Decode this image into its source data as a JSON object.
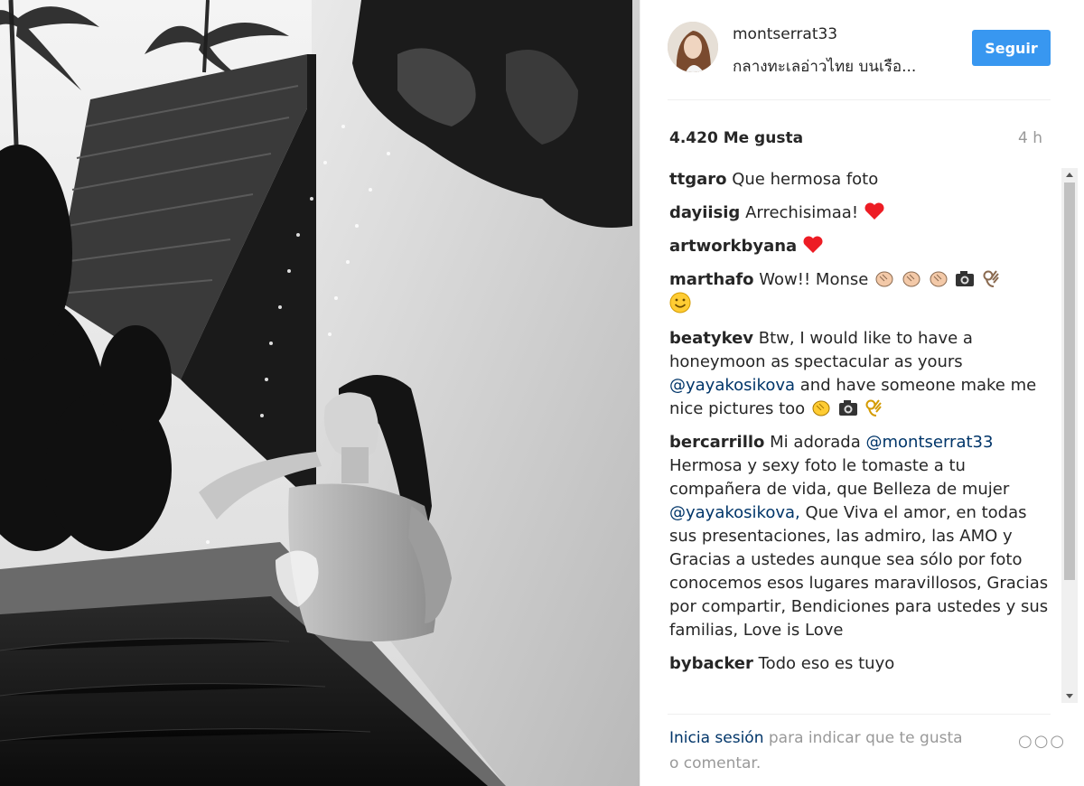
{
  "post": {
    "username": "montserrat33",
    "location": "กลางทะเลอ่าวไทย บนเรือ...",
    "follow_label": "Seguir",
    "likes": "4.420 Me gusta",
    "time": "4 h"
  },
  "comments": [
    {
      "user": "ttgaro",
      "text": "Que hermosa foto"
    },
    {
      "user": "dayiisig",
      "text": "Arrechisimaa!"
    },
    {
      "user": "artworkbyana",
      "text": ""
    },
    {
      "user": "marthafo",
      "text": "Wow!! Monse"
    },
    {
      "user": "beatykev",
      "text_1": "Btw, I would like to have a honeymoon as spectacular as yours",
      "mention": "@yayakosikova",
      "text_2": "and have someone make me nice pictures too"
    },
    {
      "user": "bercarrillo",
      "text_1": "Mi adorada",
      "mention_1": "@montserrat33",
      "text_2": "Hermosa y sexy foto le tomaste a tu compañera de vida, que Belleza de mujer",
      "mention_2": "@yayakosikova,",
      "text_3": "Que Viva el amor, en todas sus presentaciones, las admiro, las AMO y Gracias a ustedes aunque sea sólo por foto conocemos esos lugares maravillosos, Gracias por compartir, Bendiciones para ustedes y sus familias, Love is Love"
    },
    {
      "user": "bybacker",
      "text": "Todo eso es tuyo"
    }
  ],
  "footer": {
    "login_label": "Inicia sesión",
    "rest": "para indicar que te gusta o comentar.",
    "more": "○○○"
  },
  "icons": {
    "heart": "heart-icon",
    "clap": "clapping-hands-icon",
    "camera": "camera-icon",
    "ok": "ok-hand-icon",
    "smile": "smiley-icon"
  },
  "colors": {
    "accent": "#3897f0",
    "heart": "#ed1c24",
    "mention": "#003569",
    "muted": "#999999"
  }
}
